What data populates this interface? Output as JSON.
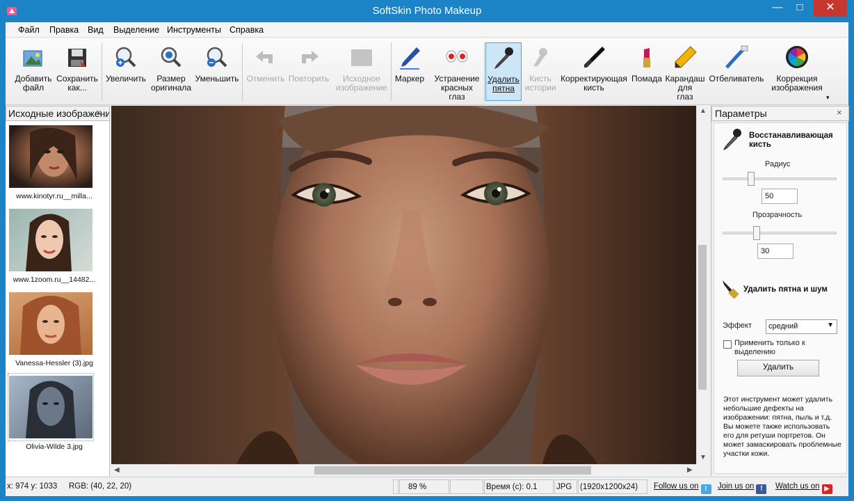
{
  "window": {
    "title": "SoftSkin Photo Makeup",
    "min": "—",
    "max": "□",
    "close": "✕"
  },
  "menu": [
    "Файл",
    "Правка",
    "Вид",
    "Выделение",
    "Инструменты",
    "Справка"
  ],
  "toolbar": {
    "add_file": [
      "Добавить",
      "файл"
    ],
    "save_as": [
      "Сохранить",
      "как..."
    ],
    "zoom_in": [
      "Увеличить"
    ],
    "original_size": [
      "Размер",
      "оригинала"
    ],
    "zoom_out": [
      "Уменьшить"
    ],
    "undo": [
      "Отменить"
    ],
    "redo": [
      "Повторить"
    ],
    "source_image": [
      "Исходное",
      "изображение"
    ],
    "marker": [
      "Маркер"
    ],
    "red_eye": [
      "Устранение",
      "красных",
      "глаз"
    ],
    "remove_spots": [
      "Удалить",
      "пятна"
    ],
    "history_brush": [
      "Кисть",
      "истории"
    ],
    "correct_brush": [
      "Корректирующая",
      "кисть"
    ],
    "lipstick": [
      "Помада"
    ],
    "eye_pencil": [
      "Карандаш",
      "для",
      "глаз"
    ],
    "whitener": [
      "Отбеливатель"
    ],
    "color_correct": [
      "Коррекция",
      "изображения"
    ],
    "more": "▾"
  },
  "left_panel": {
    "title": "Исходные изображения",
    "close": "×",
    "items": [
      {
        "label": "www.kinotyr.ru__milla..."
      },
      {
        "label": "www.1zoom.ru__14482..."
      },
      {
        "label": "Vanessa-Hessler (3).jpg"
      },
      {
        "label": "Olivia-Wilde 3.jpg"
      }
    ]
  },
  "params": {
    "title": "Параметры",
    "close": "×",
    "restore_brush_title": "Восстанавливающая кисть",
    "radius_label": "Радиус",
    "radius_value": "50",
    "radius_level": 0.25,
    "opacity_label": "Прозрачность",
    "opacity_value": "30",
    "opacity_level": 0.3,
    "remove_title": "Удалить пятна и шум",
    "effect_label": "Эффект",
    "effect_value": "средний",
    "apply_selection": "Применить только к выделению",
    "apply_checked": false,
    "delete_button": "Удалить",
    "description": "Этот инструмент может удалить небольшие дефекты на изображении: пятна, пыль и т.д. Вы можете также использовать его для ретуши портретов. Он может замаскировать проблемные участки кожи."
  },
  "status": {
    "coords": "x: 974  y: 1033",
    "rgb": "RGB: (40, 22, 20)",
    "zoom": "89 %",
    "time": "Время (с): 0.1",
    "format": "JPG",
    "dimensions": "(1920x1200x24)",
    "follow": "Follow us on",
    "join": "Join us on",
    "watch": "Watch us on"
  },
  "colors": {
    "titlebar": "#1c84c6",
    "close": "#c7372f",
    "active_tool": "#cde6f7"
  }
}
